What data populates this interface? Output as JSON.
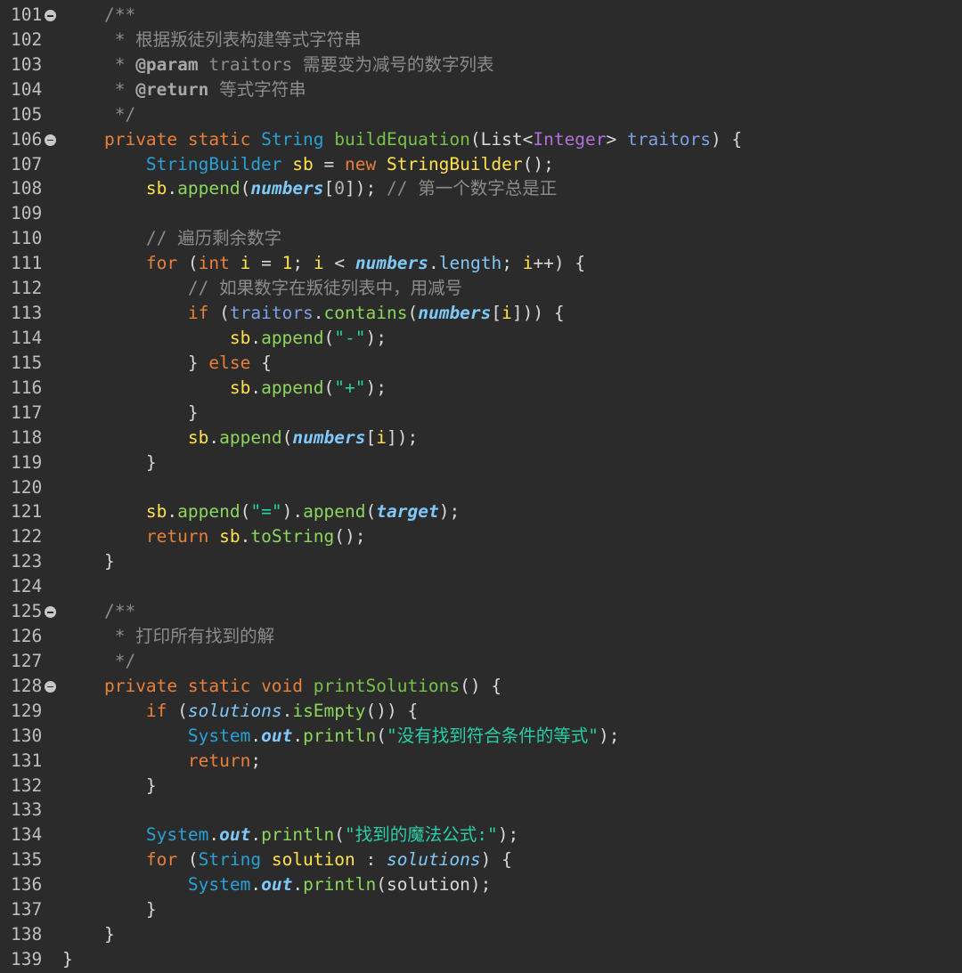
{
  "colors": {
    "background": "#2b2b2b",
    "line_number": "#bfbfbf",
    "fold_marker": "#c8c8c8",
    "plain": "#d8d8d8",
    "comment": "#8c8c8c",
    "javadoc_tag": "#a7a7a7",
    "keyword": "#e8803a",
    "type": "#2aa1d6",
    "generic": "#b36fd9",
    "method_decl": "#78c14a",
    "method_call": "#8dd55c",
    "param": "#7d9fe3",
    "local_var": "#ffe14d",
    "field": "#7fc8f8",
    "static_field": "#7fc8f8",
    "string": "#29cfa6",
    "number": "#b4b4b4"
  },
  "editor": {
    "lines": [
      {
        "num": "101",
        "fold": true,
        "indent": "    ",
        "tokens": [
          {
            "t": "/**",
            "c": "comment"
          }
        ]
      },
      {
        "num": "102",
        "indent": "     ",
        "tokens": [
          {
            "t": "* 根据叛徒列表构建等式字符串",
            "c": "comment"
          }
        ]
      },
      {
        "num": "103",
        "indent": "     ",
        "tokens": [
          {
            "t": "* ",
            "c": "comment"
          },
          {
            "t": "@param",
            "c": "javadoc_tag",
            "s": "b"
          },
          {
            "t": " traitors 需要变为减号的数字列表",
            "c": "comment"
          }
        ]
      },
      {
        "num": "104",
        "indent": "     ",
        "tokens": [
          {
            "t": "* ",
            "c": "comment"
          },
          {
            "t": "@return",
            "c": "javadoc_tag",
            "s": "b"
          },
          {
            "t": " 等式字符串",
            "c": "comment"
          }
        ]
      },
      {
        "num": "105",
        "indent": "     ",
        "tokens": [
          {
            "t": "*/",
            "c": "comment"
          }
        ]
      },
      {
        "num": "106",
        "fold": true,
        "indent": "    ",
        "tokens": [
          {
            "t": "private static ",
            "c": "keyword"
          },
          {
            "t": "String ",
            "c": "type"
          },
          {
            "t": "buildEquation",
            "c": "method_decl"
          },
          {
            "t": "(",
            "c": "plain"
          },
          {
            "t": "List<",
            "c": "plain"
          },
          {
            "t": "Integer",
            "c": "generic"
          },
          {
            "t": "> ",
            "c": "plain"
          },
          {
            "t": "traitors",
            "c": "param"
          },
          {
            "t": ") {",
            "c": "plain"
          }
        ]
      },
      {
        "num": "107",
        "indent": "        ",
        "tokens": [
          {
            "t": "StringBuilder ",
            "c": "type"
          },
          {
            "t": "sb",
            "c": "local_var"
          },
          {
            "t": " = ",
            "c": "plain"
          },
          {
            "t": "new ",
            "c": "keyword"
          },
          {
            "t": "StringBuilder",
            "c": "local_var"
          },
          {
            "t": "();",
            "c": "plain"
          }
        ]
      },
      {
        "num": "108",
        "indent": "        ",
        "tokens": [
          {
            "t": "sb",
            "c": "local_var"
          },
          {
            "t": ".",
            "c": "plain"
          },
          {
            "t": "append",
            "c": "method_call"
          },
          {
            "t": "(",
            "c": "plain"
          },
          {
            "t": "numbers",
            "c": "field",
            "s": "bi"
          },
          {
            "t": "[",
            "c": "plain"
          },
          {
            "t": "0",
            "c": "number"
          },
          {
            "t": "]); ",
            "c": "plain"
          },
          {
            "t": "// 第一个数字总是正",
            "c": "comment"
          }
        ]
      },
      {
        "num": "109",
        "indent": "",
        "tokens": []
      },
      {
        "num": "110",
        "indent": "        ",
        "tokens": [
          {
            "t": "// 遍历剩余数字",
            "c": "comment"
          }
        ]
      },
      {
        "num": "111",
        "indent": "        ",
        "tokens": [
          {
            "t": "for ",
            "c": "keyword"
          },
          {
            "t": "(",
            "c": "plain"
          },
          {
            "t": "int ",
            "c": "keyword"
          },
          {
            "t": "i",
            "c": "local_var"
          },
          {
            "t": " = ",
            "c": "plain"
          },
          {
            "t": "1",
            "c": "local_var"
          },
          {
            "t": "; ",
            "c": "plain"
          },
          {
            "t": "i",
            "c": "local_var"
          },
          {
            "t": " < ",
            "c": "plain"
          },
          {
            "t": "numbers",
            "c": "field",
            "s": "bi"
          },
          {
            "t": ".",
            "c": "plain"
          },
          {
            "t": "length",
            "c": "field"
          },
          {
            "t": "; ",
            "c": "plain"
          },
          {
            "t": "i",
            "c": "local_var"
          },
          {
            "t": "++) {",
            "c": "plain"
          }
        ]
      },
      {
        "num": "112",
        "indent": "            ",
        "tokens": [
          {
            "t": "// 如果数字在叛徒列表中，用减号",
            "c": "comment"
          }
        ]
      },
      {
        "num": "113",
        "indent": "            ",
        "tokens": [
          {
            "t": "if ",
            "c": "keyword"
          },
          {
            "t": "(",
            "c": "plain"
          },
          {
            "t": "traitors",
            "c": "param"
          },
          {
            "t": ".",
            "c": "plain"
          },
          {
            "t": "contains",
            "c": "method_call"
          },
          {
            "t": "(",
            "c": "plain"
          },
          {
            "t": "numbers",
            "c": "field",
            "s": "bi"
          },
          {
            "t": "[",
            "c": "plain"
          },
          {
            "t": "i",
            "c": "local_var"
          },
          {
            "t": "])) {",
            "c": "plain"
          }
        ]
      },
      {
        "num": "114",
        "indent": "                ",
        "tokens": [
          {
            "t": "sb",
            "c": "local_var"
          },
          {
            "t": ".",
            "c": "plain"
          },
          {
            "t": "append",
            "c": "method_call"
          },
          {
            "t": "(",
            "c": "plain"
          },
          {
            "t": "\"-\"",
            "c": "string"
          },
          {
            "t": ");",
            "c": "plain"
          }
        ]
      },
      {
        "num": "115",
        "indent": "            ",
        "tokens": [
          {
            "t": "} ",
            "c": "plain"
          },
          {
            "t": "else",
            "c": "keyword"
          },
          {
            "t": " {",
            "c": "plain"
          }
        ]
      },
      {
        "num": "116",
        "indent": "                ",
        "tokens": [
          {
            "t": "sb",
            "c": "local_var"
          },
          {
            "t": ".",
            "c": "plain"
          },
          {
            "t": "append",
            "c": "method_call"
          },
          {
            "t": "(",
            "c": "plain"
          },
          {
            "t": "\"+\"",
            "c": "string"
          },
          {
            "t": ");",
            "c": "plain"
          }
        ]
      },
      {
        "num": "117",
        "indent": "            ",
        "tokens": [
          {
            "t": "}",
            "c": "plain"
          }
        ]
      },
      {
        "num": "118",
        "indent": "            ",
        "tokens": [
          {
            "t": "sb",
            "c": "local_var"
          },
          {
            "t": ".",
            "c": "plain"
          },
          {
            "t": "append",
            "c": "method_call"
          },
          {
            "t": "(",
            "c": "plain"
          },
          {
            "t": "numbers",
            "c": "field",
            "s": "bi"
          },
          {
            "t": "[",
            "c": "plain"
          },
          {
            "t": "i",
            "c": "local_var"
          },
          {
            "t": "]);",
            "c": "plain"
          }
        ]
      },
      {
        "num": "119",
        "indent": "        ",
        "tokens": [
          {
            "t": "}",
            "c": "plain"
          }
        ]
      },
      {
        "num": "120",
        "indent": "",
        "tokens": []
      },
      {
        "num": "121",
        "indent": "        ",
        "tokens": [
          {
            "t": "sb",
            "c": "local_var"
          },
          {
            "t": ".",
            "c": "plain"
          },
          {
            "t": "append",
            "c": "method_call"
          },
          {
            "t": "(",
            "c": "plain"
          },
          {
            "t": "\"=\"",
            "c": "string"
          },
          {
            "t": ").",
            "c": "plain"
          },
          {
            "t": "append",
            "c": "method_call"
          },
          {
            "t": "(",
            "c": "plain"
          },
          {
            "t": "target",
            "c": "field",
            "s": "bi"
          },
          {
            "t": ");",
            "c": "plain"
          }
        ]
      },
      {
        "num": "122",
        "indent": "        ",
        "tokens": [
          {
            "t": "return ",
            "c": "keyword"
          },
          {
            "t": "sb",
            "c": "local_var"
          },
          {
            "t": ".",
            "c": "plain"
          },
          {
            "t": "toString",
            "c": "method_call"
          },
          {
            "t": "();",
            "c": "plain"
          }
        ]
      },
      {
        "num": "123",
        "indent": "    ",
        "tokens": [
          {
            "t": "}",
            "c": "plain"
          }
        ]
      },
      {
        "num": "124",
        "indent": "",
        "tokens": []
      },
      {
        "num": "125",
        "fold": true,
        "indent": "    ",
        "tokens": [
          {
            "t": "/**",
            "c": "comment"
          }
        ]
      },
      {
        "num": "126",
        "indent": "     ",
        "tokens": [
          {
            "t": "* 打印所有找到的解",
            "c": "comment"
          }
        ]
      },
      {
        "num": "127",
        "indent": "     ",
        "tokens": [
          {
            "t": "*/",
            "c": "comment"
          }
        ]
      },
      {
        "num": "128",
        "fold": true,
        "indent": "    ",
        "tokens": [
          {
            "t": "private static void ",
            "c": "keyword"
          },
          {
            "t": "printSolutions",
            "c": "method_decl"
          },
          {
            "t": "() {",
            "c": "plain"
          }
        ]
      },
      {
        "num": "129",
        "indent": "        ",
        "tokens": [
          {
            "t": "if ",
            "c": "keyword"
          },
          {
            "t": "(",
            "c": "plain"
          },
          {
            "t": "solutions",
            "c": "field",
            "s": "i"
          },
          {
            "t": ".",
            "c": "plain"
          },
          {
            "t": "isEmpty",
            "c": "method_call"
          },
          {
            "t": "()) {",
            "c": "plain"
          }
        ]
      },
      {
        "num": "130",
        "indent": "            ",
        "tokens": [
          {
            "t": "System",
            "c": "type"
          },
          {
            "t": ".",
            "c": "plain"
          },
          {
            "t": "out",
            "c": "static_field",
            "s": "bi"
          },
          {
            "t": ".",
            "c": "plain"
          },
          {
            "t": "println",
            "c": "method_call"
          },
          {
            "t": "(",
            "c": "plain"
          },
          {
            "t": "\"没有找到符合条件的等式\"",
            "c": "string"
          },
          {
            "t": ");",
            "c": "plain"
          }
        ]
      },
      {
        "num": "131",
        "indent": "            ",
        "tokens": [
          {
            "t": "return",
            "c": "keyword"
          },
          {
            "t": ";",
            "c": "plain"
          }
        ]
      },
      {
        "num": "132",
        "indent": "        ",
        "tokens": [
          {
            "t": "}",
            "c": "plain"
          }
        ]
      },
      {
        "num": "133",
        "indent": "",
        "tokens": []
      },
      {
        "num": "134",
        "indent": "        ",
        "tokens": [
          {
            "t": "System",
            "c": "type"
          },
          {
            "t": ".",
            "c": "plain"
          },
          {
            "t": "out",
            "c": "static_field",
            "s": "bi"
          },
          {
            "t": ".",
            "c": "plain"
          },
          {
            "t": "println",
            "c": "method_call"
          },
          {
            "t": "(",
            "c": "plain"
          },
          {
            "t": "\"找到的魔法公式:\"",
            "c": "string"
          },
          {
            "t": ");",
            "c": "plain"
          }
        ]
      },
      {
        "num": "135",
        "indent": "        ",
        "tokens": [
          {
            "t": "for ",
            "c": "keyword"
          },
          {
            "t": "(",
            "c": "plain"
          },
          {
            "t": "String ",
            "c": "type"
          },
          {
            "t": "solution",
            "c": "local_var"
          },
          {
            "t": " : ",
            "c": "plain"
          },
          {
            "t": "solutions",
            "c": "field",
            "s": "i"
          },
          {
            "t": ") {",
            "c": "plain"
          }
        ]
      },
      {
        "num": "136",
        "indent": "            ",
        "tokens": [
          {
            "t": "System",
            "c": "type"
          },
          {
            "t": ".",
            "c": "plain"
          },
          {
            "t": "out",
            "c": "static_field",
            "s": "bi"
          },
          {
            "t": ".",
            "c": "plain"
          },
          {
            "t": "println",
            "c": "method_call"
          },
          {
            "t": "(solution);",
            "c": "plain"
          }
        ]
      },
      {
        "num": "137",
        "indent": "        ",
        "tokens": [
          {
            "t": "}",
            "c": "plain"
          }
        ]
      },
      {
        "num": "138",
        "indent": "    ",
        "tokens": [
          {
            "t": "}",
            "c": "plain"
          }
        ]
      },
      {
        "num": "139",
        "indent": "",
        "tokens": [
          {
            "t": "}",
            "c": "plain"
          }
        ]
      }
    ]
  }
}
